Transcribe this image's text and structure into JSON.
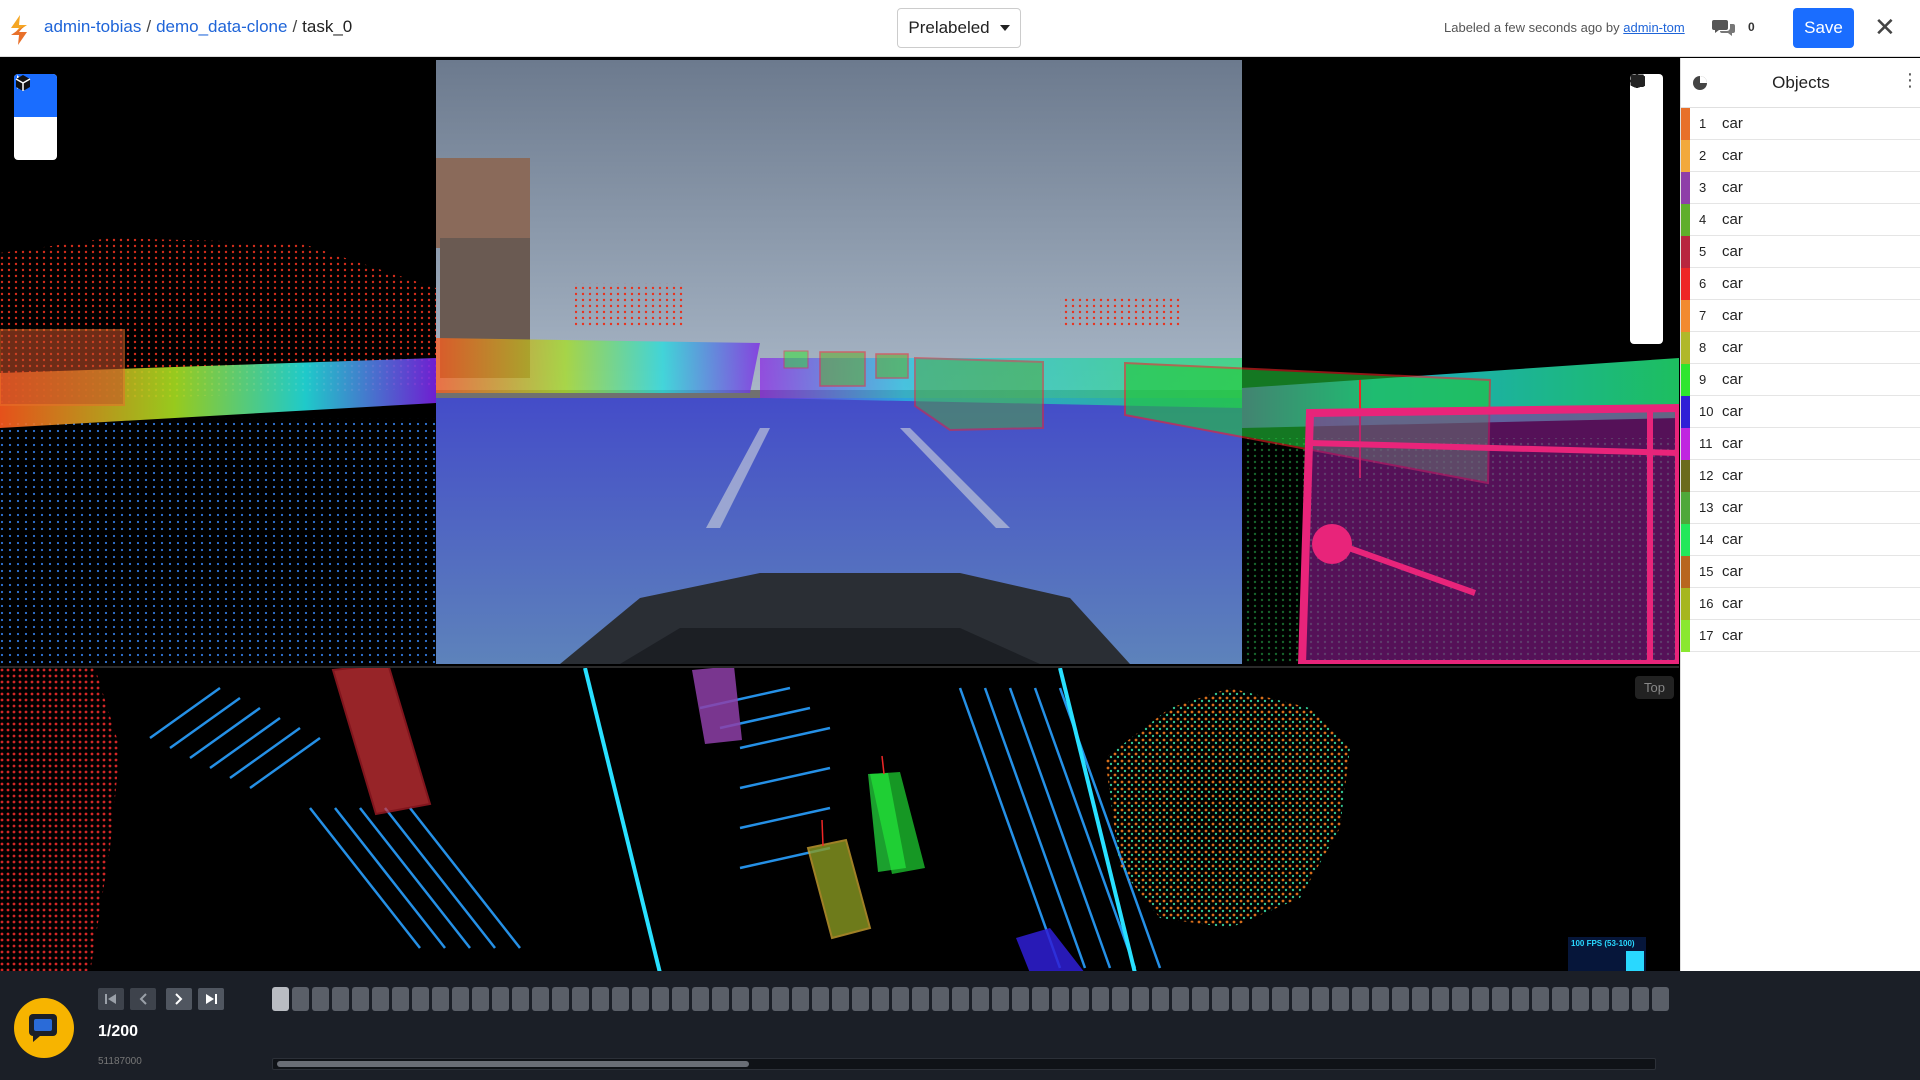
{
  "header": {
    "breadcrumb": {
      "org": "admin-tobias",
      "project": "demo_data-clone",
      "task": "task_0"
    },
    "status_dropdown": "Prelabeled",
    "labeled_text": "Labeled a few seconds ago by",
    "labeled_user": "admin-tom",
    "comment_count": "0",
    "save_label": "Save",
    "close_glyph": "✕"
  },
  "viewer": {
    "top_view_label": "Top",
    "fps_label": "100 FPS (53-100)"
  },
  "sidebar": {
    "title": "Objects",
    "objects": [
      {
        "id": "1",
        "label": "car",
        "color": "#e8702a"
      },
      {
        "id": "2",
        "label": "car",
        "color": "#f2a93b"
      },
      {
        "id": "3",
        "label": "car",
        "color": "#8e3fa8"
      },
      {
        "id": "4",
        "label": "car",
        "color": "#5fae2b"
      },
      {
        "id": "5",
        "label": "car",
        "color": "#b8253f"
      },
      {
        "id": "6",
        "label": "car",
        "color": "#ee2626"
      },
      {
        "id": "7",
        "label": "car",
        "color": "#f28a2e"
      },
      {
        "id": "8",
        "label": "car",
        "color": "#b0b82a"
      },
      {
        "id": "9",
        "label": "car",
        "color": "#2ee62e"
      },
      {
        "id": "10",
        "label": "car",
        "color": "#2f1fd6"
      },
      {
        "id": "11",
        "label": "car",
        "color": "#c025e0"
      },
      {
        "id": "12",
        "label": "car",
        "color": "#6b6b1c"
      },
      {
        "id": "13",
        "label": "car",
        "color": "#4fa83a"
      },
      {
        "id": "14",
        "label": "car",
        "color": "#22e85a"
      },
      {
        "id": "15",
        "label": "car",
        "color": "#b8651e"
      },
      {
        "id": "16",
        "label": "car",
        "color": "#a6b61e"
      },
      {
        "id": "17",
        "label": "car",
        "color": "#8ae830"
      }
    ]
  },
  "timeline": {
    "frame_counter": "1/200",
    "frame_id": "51187000",
    "total_frames": 200,
    "current_frame": 1
  },
  "icons": {
    "logo": "scale-logo-icon",
    "cursor": "cursor-icon",
    "cuboid": "cuboid-icon",
    "help": "help-icon",
    "settings": "gear-icon",
    "target": "target-icon",
    "stats": "stats-icon",
    "camera": "camera-icon",
    "map": "map-icon",
    "image": "image-icon",
    "info": "info-icon",
    "layers": "layers-icon",
    "comments": "comments-icon",
    "pie": "pie-icon",
    "kebab": "kebab-icon",
    "chat": "chat-icon"
  },
  "colors": {
    "accent": "#1a6dff",
    "link": "#1e64d8",
    "timeline_bg": "#1b1f27",
    "chat": "#f7b400"
  }
}
